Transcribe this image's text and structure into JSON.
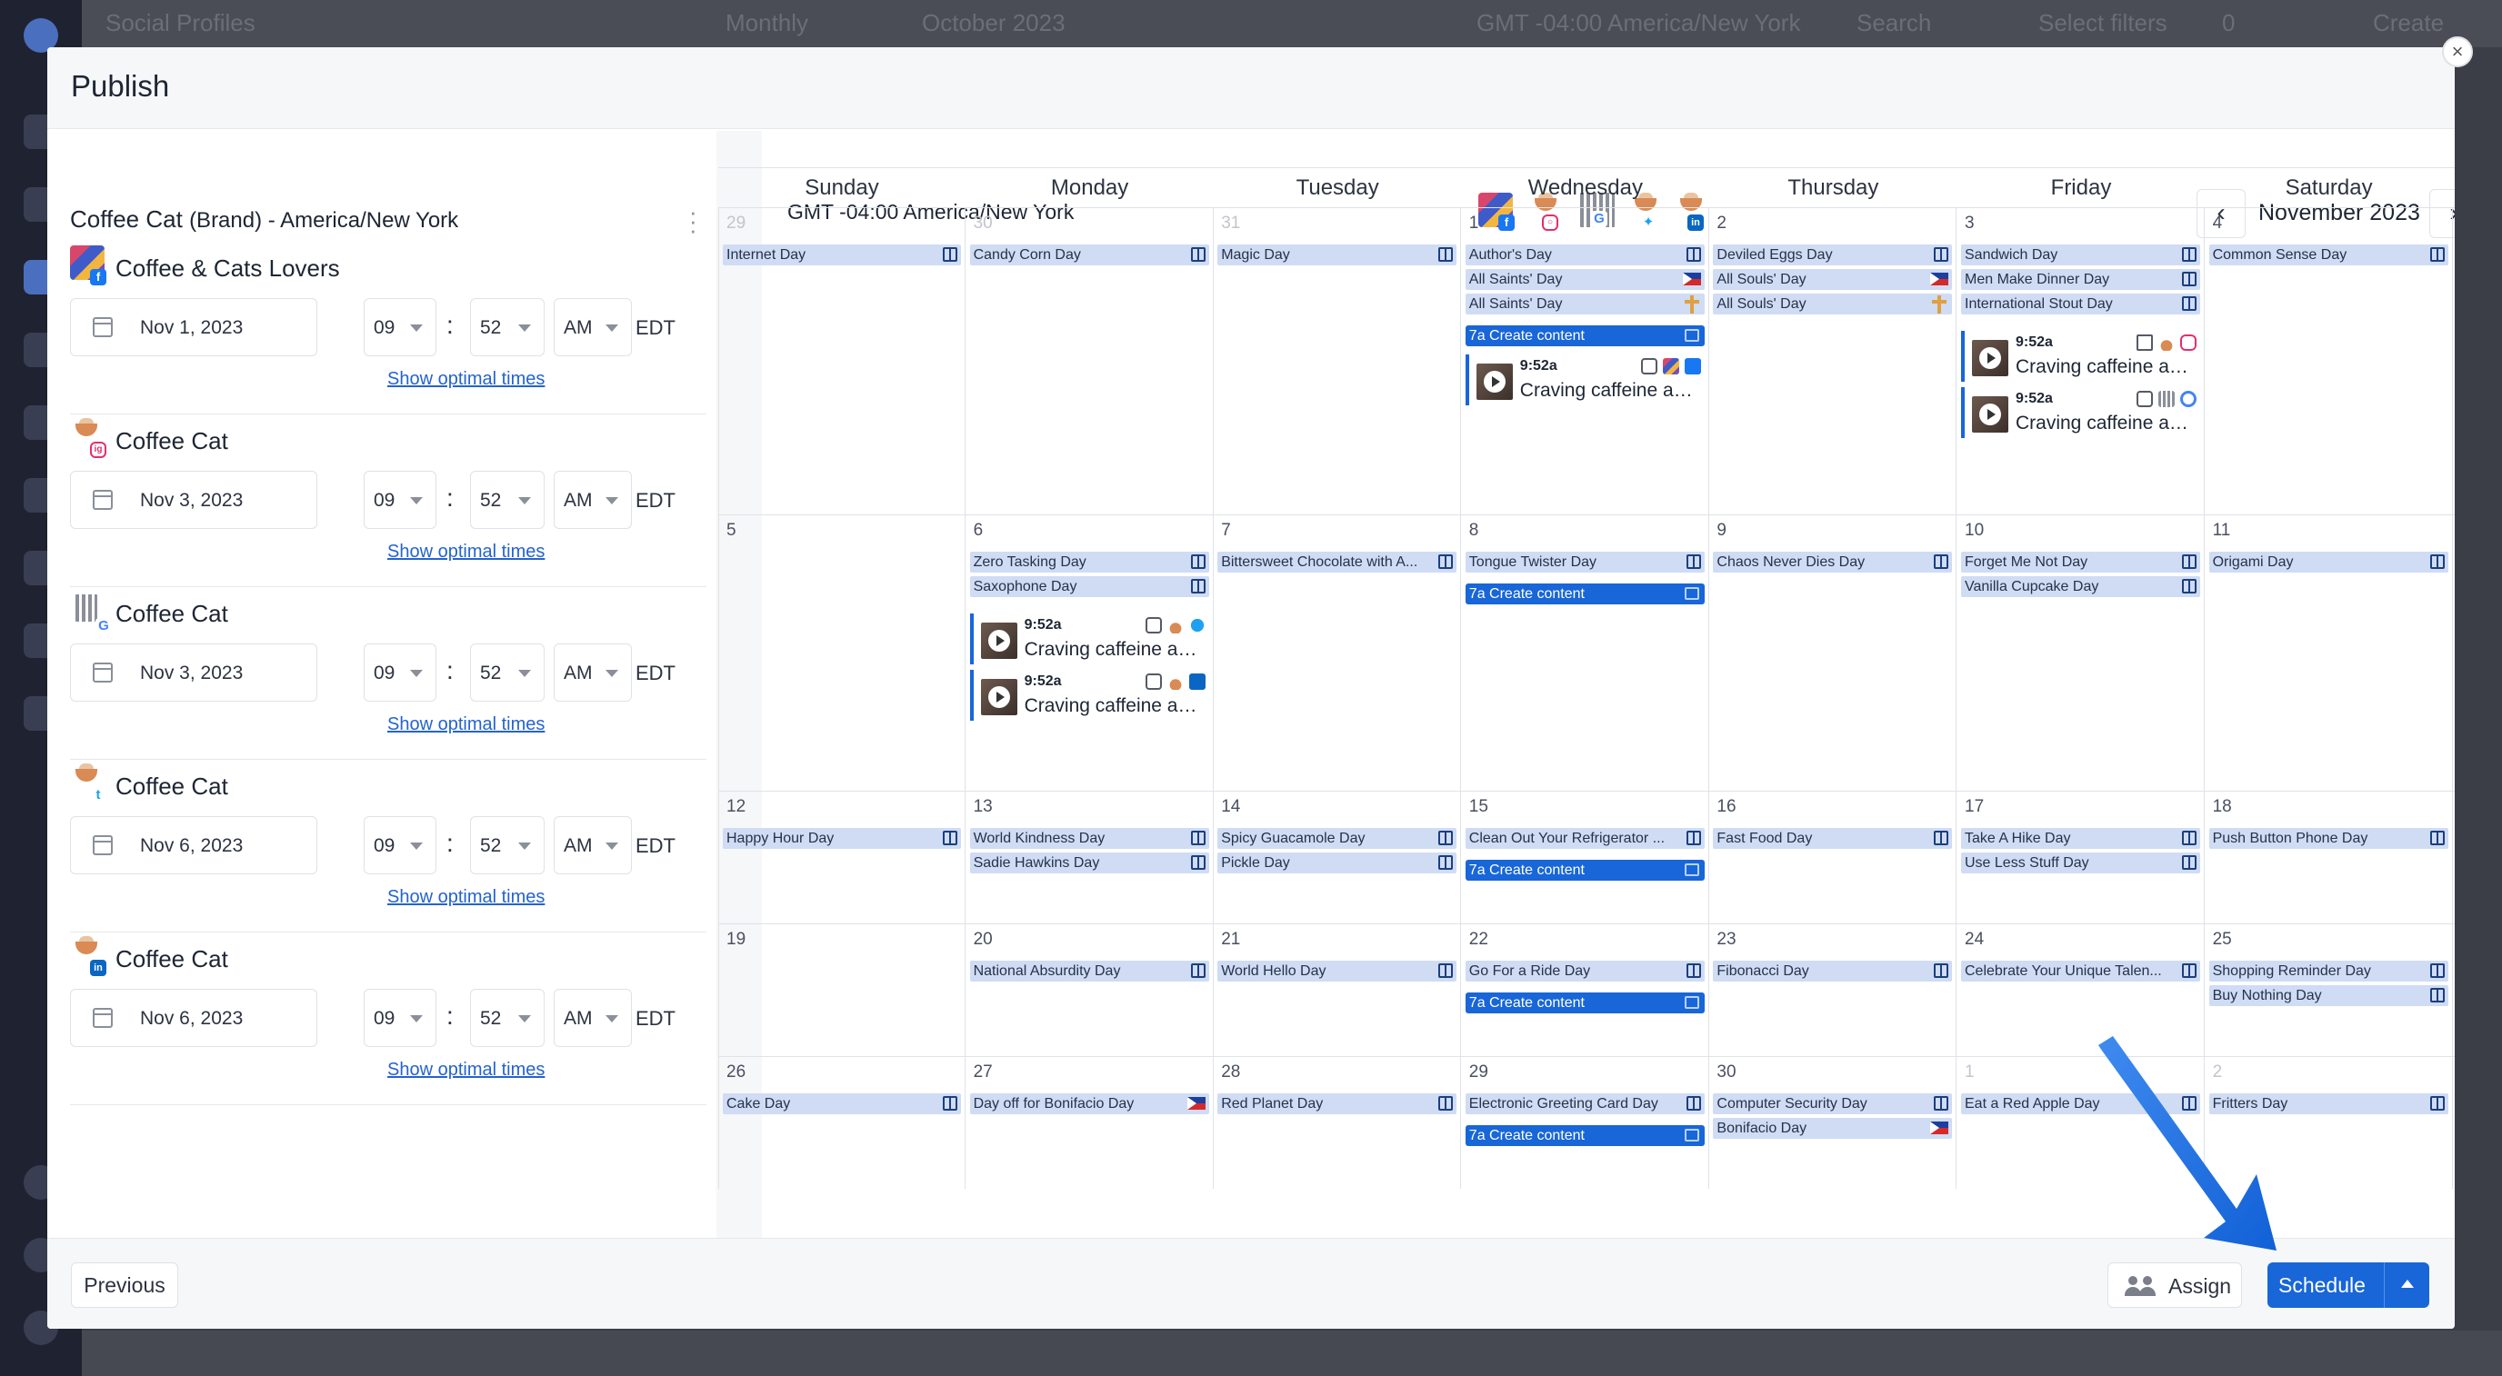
{
  "background": {
    "title": "Social Profiles",
    "view": "Monthly",
    "month": "October 2023",
    "timezone": "GMT -04:00 America/New York",
    "search": "Search",
    "filters": "Select filters",
    "filter_count": "0",
    "create": "Create"
  },
  "modal": {
    "title": "Publish",
    "close": "×"
  },
  "left": {
    "brand": "Coffee Cat",
    "brand_sub": "(Brand) - America/New York",
    "profiles": [
      {
        "name": "Coffee & Cats Lovers",
        "network": "f",
        "date": "Nov 1, 2023",
        "hour": "09",
        "minute": "52",
        "ampm": "AM",
        "tz": "EDT",
        "optimal": "Show optimal times"
      },
      {
        "name": "Coffee Cat",
        "network": "ig",
        "date": "Nov 3, 2023",
        "hour": "09",
        "minute": "52",
        "ampm": "AM",
        "tz": "EDT",
        "optimal": "Show optimal times"
      },
      {
        "name": "Coffee Cat",
        "network": "G",
        "date": "Nov 3, 2023",
        "hour": "09",
        "minute": "52",
        "ampm": "AM",
        "tz": "EDT",
        "optimal": "Show optimal times"
      },
      {
        "name": "Coffee Cat",
        "network": "t",
        "date": "Nov 6, 2023",
        "hour": "09",
        "minute": "52",
        "ampm": "AM",
        "tz": "EDT",
        "optimal": "Show optimal times"
      },
      {
        "name": "Coffee Cat",
        "network": "in",
        "date": "Nov 6, 2023",
        "hour": "09",
        "minute": "52",
        "ampm": "AM",
        "tz": "EDT",
        "optimal": "Show optimal times"
      }
    ],
    "colon": ":"
  },
  "calendar": {
    "timezone": "GMT -04:00 America/New York",
    "month": "November 2023",
    "prev": "‹",
    "next": "›",
    "days_of_week": [
      "Sunday",
      "Monday",
      "Tuesday",
      "Wednesday",
      "Thursday",
      "Friday",
      "Saturday"
    ],
    "create_label": "7a Create content",
    "post_time": "9:52a",
    "post_text": "Craving caffeine and..."
  },
  "footer": {
    "previous": "Previous",
    "assign": "Assign",
    "schedule": "Schedule"
  },
  "colors": {
    "accent": "#1866d8",
    "event_bg": "#cfdcf4",
    "arrow": "#1a6be0"
  }
}
